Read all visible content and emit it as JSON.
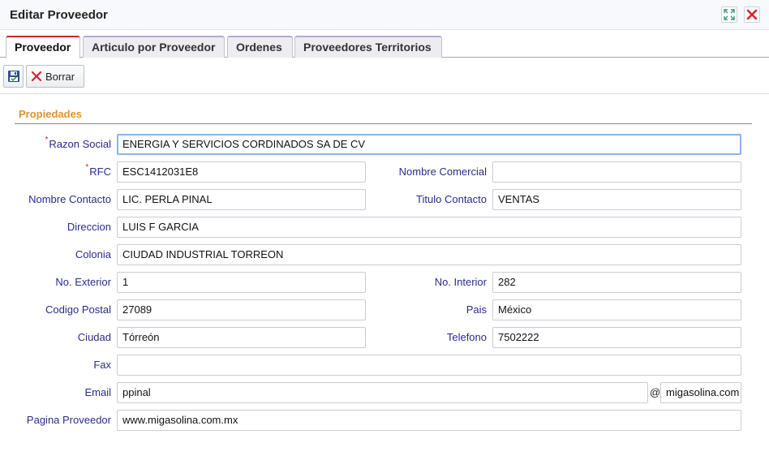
{
  "window": {
    "title": "Editar Proveedor"
  },
  "tabs": [
    {
      "label": "Proveedor",
      "active": true
    },
    {
      "label": "Articulo por Proveedor",
      "active": false
    },
    {
      "label": "Ordenes",
      "active": false
    },
    {
      "label": "Proveedores Territorios",
      "active": false
    }
  ],
  "toolbar": {
    "save_icon": "floppy-disk-icon",
    "delete_label": "Borrar",
    "delete_icon": "x-icon"
  },
  "section": {
    "title": "Propiedades"
  },
  "form": {
    "razon_social": {
      "label": "Razon Social",
      "required": "*",
      "value": "ENERGIA Y SERVICIOS CORDINADOS SA DE CV"
    },
    "rfc": {
      "label": "RFC",
      "required": "*",
      "value": "ESC1412031E8"
    },
    "nombre_comercial": {
      "label": "Nombre Comercial",
      "value": ""
    },
    "nombre_contacto": {
      "label": "Nombre Contacto",
      "value": "LIC. PERLA PINAL"
    },
    "titulo_contacto": {
      "label": "Titulo Contacto",
      "value": "VENTAS"
    },
    "direccion": {
      "label": "Direccion",
      "value": "LUIS F GARCIA"
    },
    "colonia": {
      "label": "Colonia",
      "value": "CIUDAD INDUSTRIAL TORREON"
    },
    "no_exterior": {
      "label": "No. Exterior",
      "value": "1"
    },
    "no_interior": {
      "label": "No. Interior",
      "value": "282"
    },
    "codigo_postal": {
      "label": "Codigo Postal",
      "value": "27089"
    },
    "pais": {
      "label": "Pais",
      "value": "México"
    },
    "ciudad": {
      "label": "Ciudad",
      "value": "Tórreón"
    },
    "telefono": {
      "label": "Telefono",
      "value": "7502222"
    },
    "fax": {
      "label": "Fax",
      "value": ""
    },
    "email": {
      "label": "Email",
      "user": "ppinal",
      "at": "@",
      "domain": "migasolina.com"
    },
    "pagina": {
      "label": "Pagina Proveedor",
      "value": "www.migasolina.com.mx"
    }
  },
  "colors": {
    "accent_section": "#e0922a",
    "label_color": "#2b2b8c",
    "active_tab_border": "#d8222a"
  }
}
